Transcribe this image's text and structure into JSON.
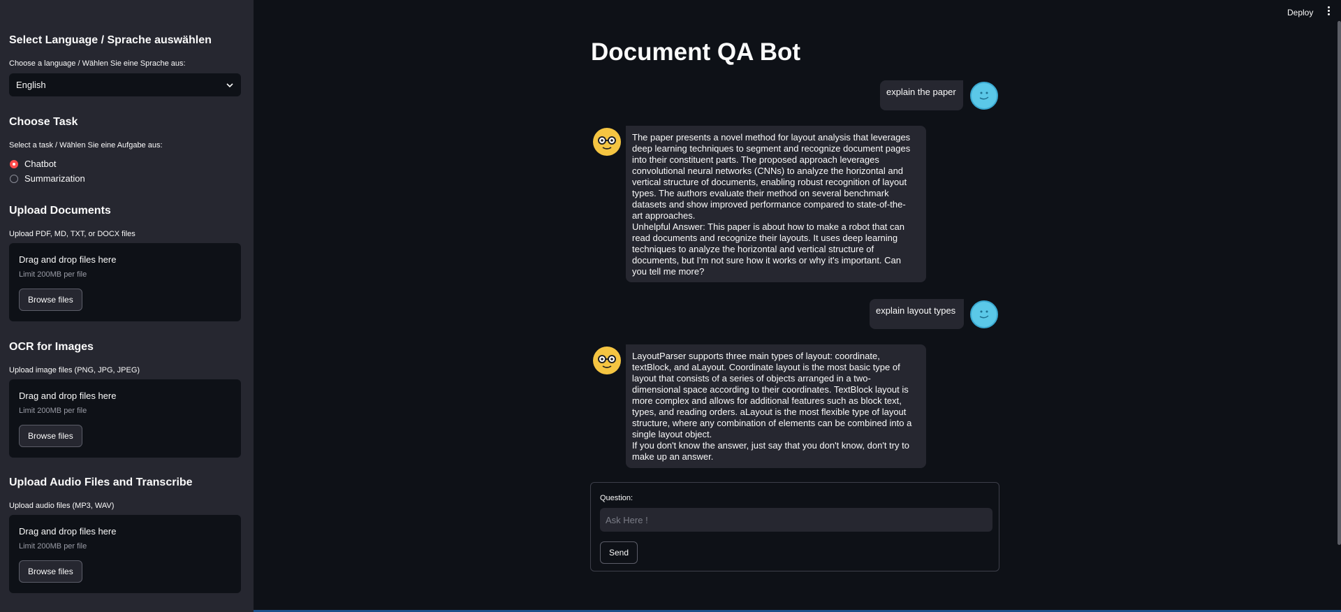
{
  "header": {
    "deploy_label": "Deploy"
  },
  "sidebar": {
    "language": {
      "heading": "Select Language / Sprache auswählen",
      "label": "Choose a language / Wählen Sie eine Sprache aus:",
      "selected": "English"
    },
    "task": {
      "heading": "Choose Task",
      "label": "Select a task / Wählen Sie eine Aufgabe aus:",
      "options": [
        "Chatbot",
        "Summarization"
      ],
      "selected": "Chatbot"
    },
    "upload_docs": {
      "heading": "Upload Documents",
      "label": "Upload PDF, MD, TXT, or DOCX files",
      "drop_title": "Drag and drop files here",
      "limit": "Limit 200MB per file",
      "button": "Browse files"
    },
    "ocr": {
      "heading": "OCR for Images",
      "label": "Upload image files (PNG, JPG, JPEG)",
      "drop_title": "Drag and drop files here",
      "limit": "Limit 200MB per file",
      "button": "Browse files"
    },
    "audio": {
      "heading": "Upload Audio Files and Transcribe",
      "label": "Upload audio files (MP3, WAV)",
      "drop_title": "Drag and drop files here",
      "limit": "Limit 200MB per file",
      "button": "Browse files"
    }
  },
  "main": {
    "title": "Document QA Bot",
    "messages": [
      {
        "role": "user",
        "text": "explain the paper"
      },
      {
        "role": "bot",
        "text": "The paper presents a novel method for layout analysis that leverages\ndeep learning techniques to segment and recognize document pages\ninto their constituent parts. The proposed approach leverages\nconvolutional neural networks (CNNs) to analyze the horizontal and\nvertical structure of documents, enabling robust recognition of layout\ntypes. The authors evaluate their method on several benchmark\ndatasets and show improved performance compared to state-of-the-\nart approaches.\nUnhelpful Answer: This paper is about how to make a robot that can\nread documents and recognize their layouts. It uses deep learning\ntechniques to analyze the horizontal and vertical structure of\ndocuments, but I'm not sure how it works or why it's important. Can\nyou tell me more?"
      },
      {
        "role": "user",
        "text": "explain layout types"
      },
      {
        "role": "bot",
        "text": "LayoutParser supports three main types of layout: coordinate,\ntextBlock, and aLayout. Coordinate layout is the most basic type of\nlayout that consists of a series of objects arranged in a two-\ndimensional space according to their coordinates. TextBlock layout is\nmore complex and allows for additional features such as block text,\ntypes, and reading orders. aLayout is the most flexible type of layout\nstructure, where any combination of elements can be combined into a\nsingle layout object.\nIf you don't know the answer, just say that you don't know, don't try to\nmake up an answer."
      }
    ],
    "form": {
      "label": "Question:",
      "placeholder": "Ask Here !",
      "send_label": "Send"
    }
  }
}
